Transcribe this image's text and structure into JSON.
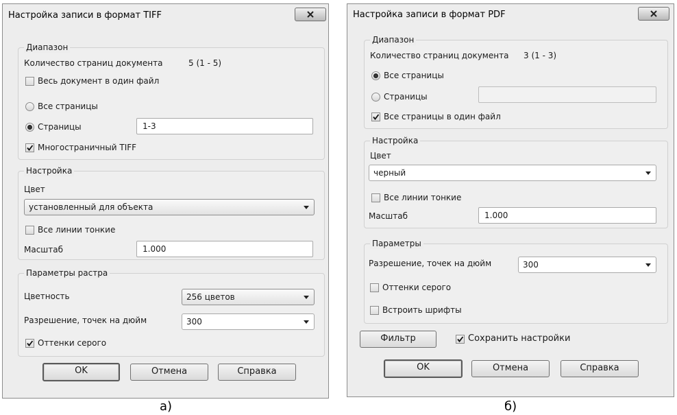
{
  "tiff": {
    "title": "Настройка записи в формат TIFF",
    "range": {
      "legend": "Диапазон",
      "pagecount_label": "Количество страниц документа",
      "pagecount_value": "5 (1 - 5)",
      "one_file_label": "Весь документ в один файл",
      "one_file_checked": false,
      "all_pages_label": "Все страницы",
      "pages_label": "Страницы",
      "pages_value": "1-3",
      "selected": "pages",
      "multipage_label": "Многостраничный TIFF",
      "multipage_checked": true
    },
    "settings": {
      "legend": "Настройка",
      "color_label": "Цвет",
      "color_value": "установленный для объекта",
      "thin_label": "Все линии тонкие",
      "thin_checked": false,
      "scale_label": "Масштаб",
      "scale_value": "1.000"
    },
    "raster": {
      "legend": "Параметры растра",
      "depth_label": "Цветность",
      "depth_value": "256 цветов",
      "resolution_label": "Разрешение, точек на дюйм",
      "resolution_value": "300",
      "gray_label": "Оттенки серого",
      "gray_checked": true
    },
    "buttons": {
      "ok": "OK",
      "cancel": "Отмена",
      "help": "Справка"
    },
    "caption": "а)"
  },
  "pdf": {
    "title": "Настройка записи в формат PDF",
    "range": {
      "legend": "Диапазон",
      "pagecount_label": "Количество страниц документа",
      "pagecount_value": "3 (1 - 3)",
      "all_pages_label": "Все страницы",
      "pages_label": "Страницы",
      "pages_value": "",
      "selected": "all",
      "one_file_label": "Все страницы в один файл",
      "one_file_checked": true
    },
    "settings": {
      "legend": "Настройка",
      "color_label": "Цвет",
      "color_value": "черный",
      "thin_label": "Все линии тонкие",
      "thin_checked": false,
      "scale_label": "Масштаб",
      "scale_value": "1.000"
    },
    "params": {
      "legend": "Параметры",
      "resolution_label": "Разрешение, точек на дюйм",
      "resolution_value": "300",
      "gray_label": "Оттенки серого",
      "gray_checked": false,
      "embed_label": "Встроить шрифты",
      "embed_checked": false
    },
    "filter_button": "Фильтр",
    "save_label": "Сохранить настройки",
    "save_checked": true,
    "buttons": {
      "ok": "OK",
      "cancel": "Отмена",
      "help": "Справка"
    },
    "caption": "б)"
  }
}
